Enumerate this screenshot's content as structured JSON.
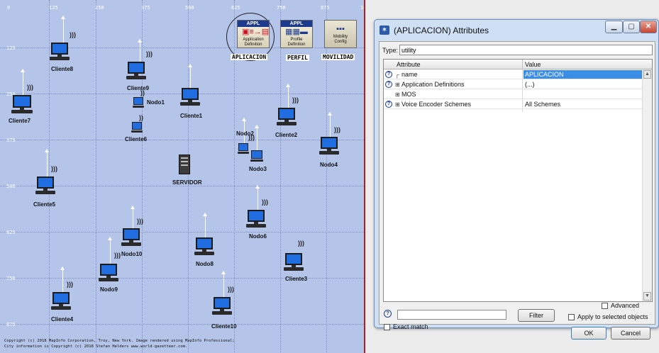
{
  "map": {
    "x_ticks": [
      "0",
      "125",
      "250",
      "375",
      "500",
      "625",
      "750",
      "875",
      "10"
    ],
    "y_ticks": [
      "125",
      "250",
      "375",
      "500",
      "625",
      "750",
      "875"
    ],
    "nodes": {
      "cliente8": "Cliente8",
      "cliente9": "Cliente9",
      "nodo1": "Nodo1",
      "cliente1": "Cliente1",
      "cliente7": "Cliente7",
      "cliente6": "Cliente6",
      "nodo2": "Nodo2",
      "cliente2": "Cliente2",
      "nodo3": "Nodo3",
      "nodo4": "Nodo4",
      "servidor": "SERVIDOR",
      "cliente5": "Cliente5",
      "nodo6": "Nodo6",
      "nodo10": "Nodo10",
      "nodo8": "Nodo8",
      "cliente3": "Cliente3",
      "nodo9": "Nodo9",
      "cliente4": "Cliente4",
      "cliente10": "Cliente10"
    },
    "config_nodes": {
      "aplicacion": {
        "header": "APPL",
        "line1": "Application",
        "line2": "Definition",
        "label": "APLICACION"
      },
      "perfil": {
        "header": "APPL",
        "line1": "Profile",
        "line2": "Definition",
        "label": "PERFIL"
      },
      "movilidad": {
        "header": "",
        "line1": "Mobility",
        "line2": "Config",
        "label": "MOVILIDAD"
      }
    },
    "copyright_line1": "Copyright (c) 2018 MapInfo Corporation, Troy, New York. Image rendered using MapInfo Professional;",
    "copyright_line2": "City information is Copyright (c) 2018 Stefan Helders www.world-gazetteer.com."
  },
  "dialog": {
    "title": "(APLICACION) Attributes",
    "type_label": "Type:",
    "type_value": "utility",
    "columns": {
      "attribute": "Attribute",
      "value": "Value"
    },
    "rows": [
      {
        "help": true,
        "expander": "┌",
        "attribute": "name",
        "value": "APLICACION",
        "selected": true
      },
      {
        "help": true,
        "expander": "⊞",
        "attribute": "Application Definitions",
        "value": "(...)",
        "selected": false
      },
      {
        "help": false,
        "expander": "⊞",
        "attribute": "MOS",
        "value": "",
        "selected": false
      },
      {
        "help": true,
        "expander": "⊞",
        "attribute": "Voice Encoder Schemes",
        "value": "All Schemes",
        "selected": false
      }
    ],
    "filter_value": "",
    "filter_button": "Filter",
    "exact_match_label": "Exact match",
    "advanced_label": "Advanced",
    "apply_selected_label": "Apply to selected objects",
    "ok_button": "OK",
    "cancel_button": "Cancel"
  },
  "icons": {
    "help": "question-circle-icon",
    "minimize": "minimize-icon",
    "maximize": "maximize-icon",
    "close": "close-icon",
    "app": "opnet-attributes-icon"
  },
  "colors": {
    "map_bg": "#b5c5ea",
    "selection": "#3a8ee6",
    "screen": "#1f6de0"
  }
}
